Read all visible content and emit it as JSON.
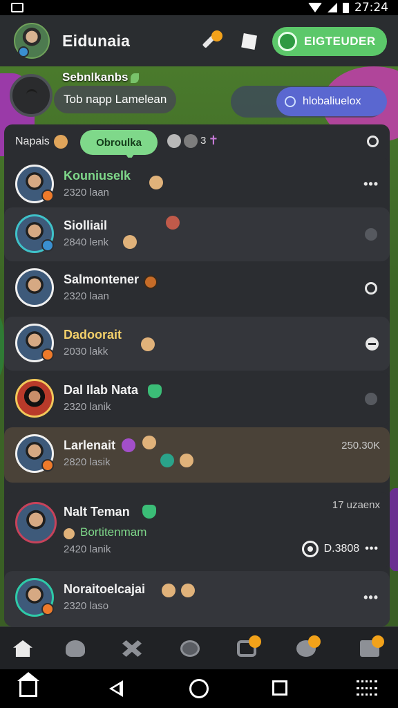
{
  "status_bar": {
    "time": "27:24"
  },
  "header": {
    "title": "Eidunaia",
    "cta_label": "EIGTEUDER",
    "icons": [
      "tool-icon",
      "tag-icon",
      "cta-icon"
    ]
  },
  "profile_preview": {
    "name": "Sebnlkanbs",
    "message": "Tob napp Lamelean",
    "pill_label": "hlobaliuelox"
  },
  "filter": {
    "label": "Napais",
    "chip": "Obroulka",
    "count": "3"
  },
  "chats": [
    {
      "name": "Kouniuselk",
      "sub": "2320 laan"
    },
    {
      "name": "Siolliail",
      "sub": "2840 lenk"
    },
    {
      "name": "Salmontener",
      "sub": "2320 laan"
    },
    {
      "name": "Dadoorait",
      "sub": "2030 lakk"
    },
    {
      "name": "Dal Ilab Nata",
      "sub": "2320 lanik"
    },
    {
      "name": "Larlenait",
      "sub": "2820 lasik",
      "meta": "250.30K"
    },
    {
      "name": "Nalt Teman",
      "meta": "17 uzaenx",
      "sub_green": "Bortitenmam",
      "sub2": "2420 lanik",
      "amount": "D.3808"
    },
    {
      "name": "Noraitoelcajai",
      "sub": "2320 laso"
    }
  ],
  "app_nav": [
    "home-icon",
    "pets-icon",
    "tools-icon",
    "wrench-icon",
    "box-icon",
    "heart-icon",
    "stack-icon"
  ],
  "system_nav": [
    "home-icon",
    "back-icon",
    "circle-icon",
    "square-icon",
    "menu-icon"
  ]
}
